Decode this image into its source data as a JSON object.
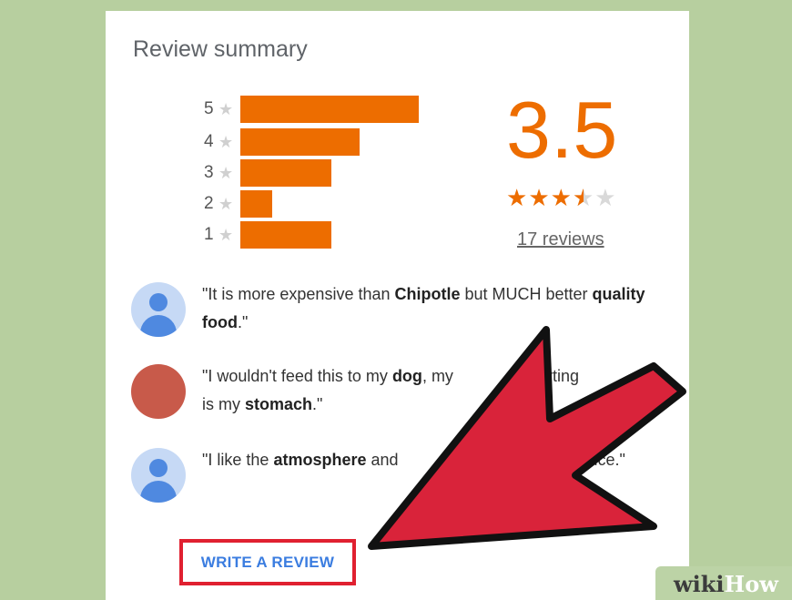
{
  "card": {
    "title": "Review summary"
  },
  "histogram": [
    {
      "label": "5",
      "fraction": 1.0
    },
    {
      "label": "4",
      "fraction": 0.67
    },
    {
      "label": "3",
      "fraction": 0.51
    },
    {
      "label": "2",
      "fraction": 0.18
    },
    {
      "label": "1",
      "fraction": 0.51
    }
  ],
  "rating": {
    "score": "3.5",
    "stars": 3.5,
    "max_stars": 5,
    "reviews_link": "17 reviews"
  },
  "reviews": [
    {
      "avatar": "user-icon",
      "before": "\"It is more expensive than ",
      "bold1": "Chipotle",
      "middle": " but MUCH better ",
      "bold2": "quality food",
      "after": ".\""
    },
    {
      "avatar": "red-circle",
      "before": "\"I wouldn't feed this to my ",
      "bold1": "dog",
      "middle": ", my",
      "gap": " is hurting",
      "after2": " is my ",
      "bold2": "stomach",
      "after": ".\""
    },
    {
      "avatar": "user-icon",
      "before": "\"I like the ",
      "bold1": "atmosphere",
      "middle": " and",
      "tail": " nice.\""
    }
  ],
  "actions": {
    "write_review": "WRITE A REVIEW"
  },
  "watermark": {
    "wiki": "wiki",
    "how": "How"
  },
  "colors": {
    "accent": "#ed6d00",
    "arrow": "#d9233a",
    "link": "#3b7de0"
  }
}
